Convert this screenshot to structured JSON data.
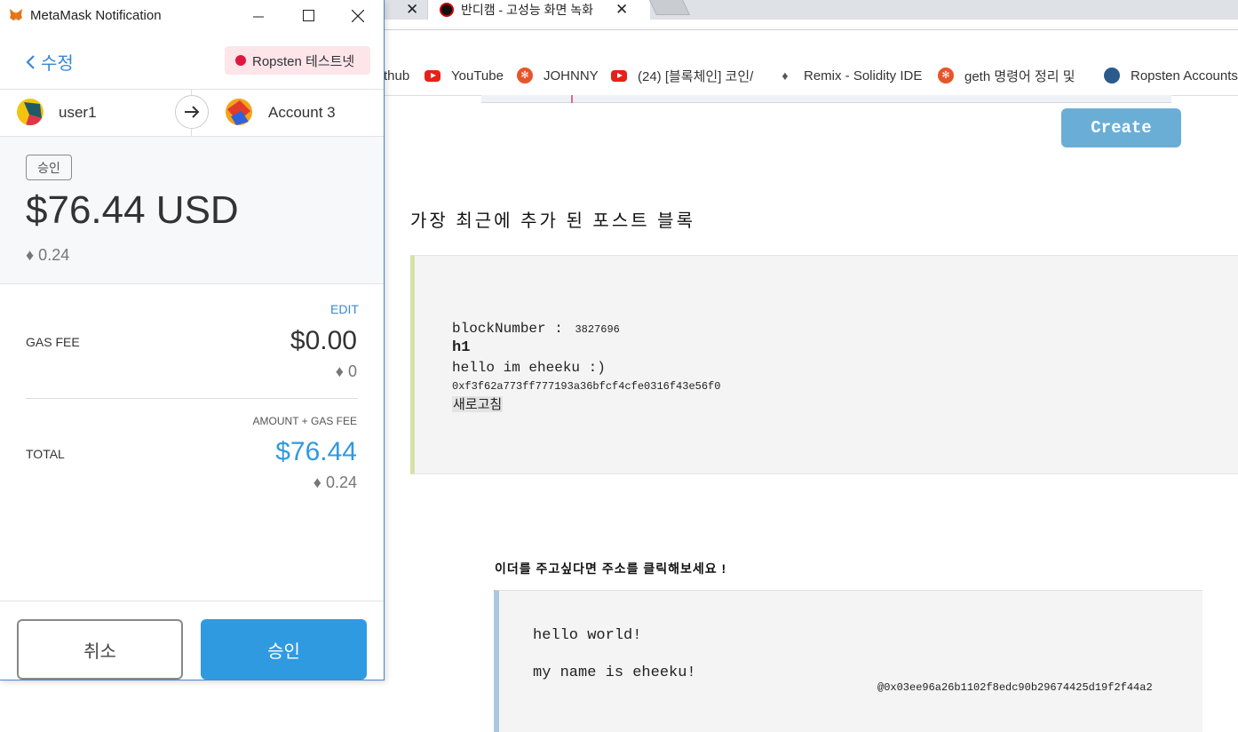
{
  "browser": {
    "tab_prev_close": "✕",
    "tab": {
      "title": "반디캠 - 고성능 화면 녹화",
      "close": "✕"
    },
    "bookmarks": [
      {
        "label": "thub",
        "icon": "none"
      },
      {
        "label": "YouTube",
        "icon": "youtube-icon"
      },
      {
        "label": "JOHNNY",
        "icon": "bookmark-favicon"
      },
      {
        "label": "(24) [블록체인] 코인/",
        "icon": "youtube-icon"
      },
      {
        "label": "Remix - Solidity IDE",
        "icon": "remix-icon"
      },
      {
        "label": "geth 명령어 정리 및",
        "icon": "bookmark-favicon"
      },
      {
        "label": "Ropsten Accounts",
        "icon": "etherscan-icon"
      }
    ]
  },
  "page": {
    "create_label": "Create",
    "recent_title": "가장 최근에 추가 된 포스트 블록",
    "block": {
      "block_number_label": "blockNumber :",
      "block_number": "3827696",
      "heading": "h1",
      "message": "hello im eheeku :)",
      "address": "0xf3f62a773ff777193a36bfcf4cfe0316f43e56f0",
      "refresh_label": "새로고침"
    },
    "donate_title": "이더를 주고싶다면 주소를 클릭해보세요 !",
    "hello": {
      "line1": "hello world!",
      "line2": "my name is eheeku!",
      "address": "@0x03ee96a26b1102f8edc90b29674425d19f2f44a2"
    }
  },
  "metamask": {
    "window_title": "MetaMask Notification",
    "back_label": "수정",
    "network_label": "Ropsten 테스트넷",
    "from_account": "user1",
    "to_account": "Account 3",
    "status_badge": "승인",
    "amount_usd": "$76.44 USD",
    "amount_eth": "♦ 0.24",
    "edit_label": "EDIT",
    "gas_fee_label": "GAS FEE",
    "gas_fee_usd": "$0.00",
    "gas_fee_eth": "♦ 0",
    "amount_gas_label": "AMOUNT + GAS FEE",
    "total_label": "TOTAL",
    "total_usd": "$76.44",
    "total_eth": "♦ 0.24",
    "cancel_label": "취소",
    "approve_label": "승인",
    "colors": {
      "accent": "#2f9ae0",
      "network_dot": "#e0193c",
      "link": "#3a88d6"
    }
  }
}
